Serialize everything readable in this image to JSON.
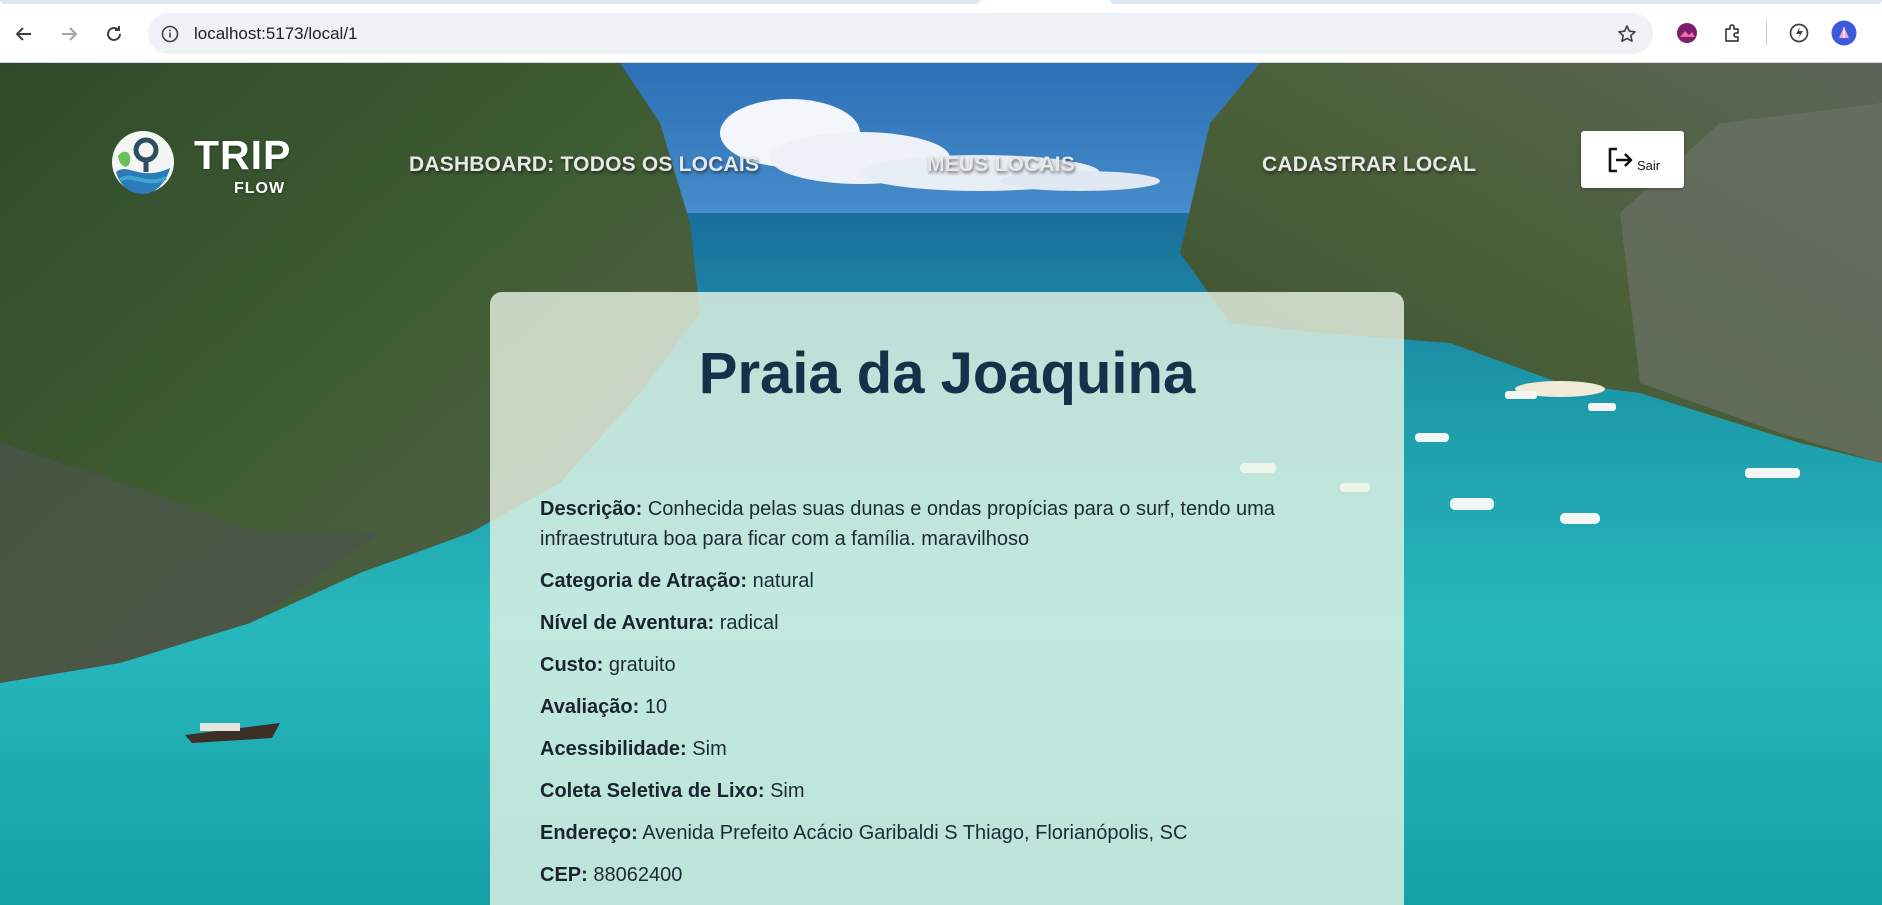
{
  "browser": {
    "url": "localhost:5173/local/1"
  },
  "navbar": {
    "logo_main": "TRIP",
    "logo_sub": "FLOW",
    "links": [
      {
        "label": "DASHBOARD: TODOS OS LOCAIS"
      },
      {
        "label": "MEUS LOCAIS"
      },
      {
        "label": "CADASTRAR LOCAL"
      }
    ],
    "logout_label": "Sair"
  },
  "place": {
    "title": "Praia da Joaquina",
    "details": [
      {
        "label": "Descrição:",
        "value": "Conhecida pelas suas dunas e ondas propícias para o surf, tendo uma infraestrutura boa para ficar com a família. maravilhoso"
      },
      {
        "label": "Categoria de Atração:",
        "value": "natural"
      },
      {
        "label": "Nível de Aventura:",
        "value": "radical"
      },
      {
        "label": "Custo:",
        "value": "gratuito"
      },
      {
        "label": "Avaliação:",
        "value": "10"
      },
      {
        "label": "Acessibilidade:",
        "value": "Sim"
      },
      {
        "label": "Coleta Seletiva de Lixo:",
        "value": "Sim"
      },
      {
        "label": "Endereço:",
        "value": "Avenida Prefeito Acácio Garibaldi S Thiago, Florianópolis, SC"
      },
      {
        "label": "CEP:",
        "value": "88062400"
      }
    ]
  },
  "theme": {
    "title_color": "#14314a",
    "card_bg": "rgba(233,245,230,0.80)"
  }
}
